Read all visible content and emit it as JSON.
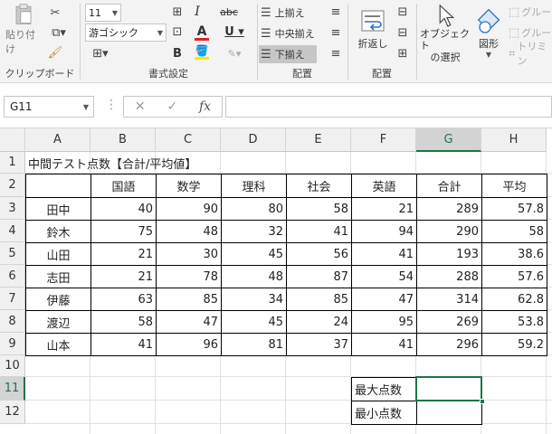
{
  "ribbon": {
    "clipboard": {
      "paste_label": "貼り付け",
      "group_label": "クリップボード"
    },
    "font": {
      "size_value": "11",
      "font_name": "游ゴシック",
      "group_label": "書式設定"
    },
    "alignment": {
      "top_label": "上揃え",
      "middle_label": "中央揃え",
      "bottom_label": "下揃え",
      "wrap_label": "折返し",
      "group_label": "配置"
    },
    "arrange": {
      "group_label": "配置",
      "select_objects_label": "オブジェクト\nの選択",
      "select_line1": "オブジェクト",
      "select_line2": "の選択",
      "shapes_label": "図形",
      "group_btn1": "グルー",
      "group_btn2": "グルー",
      "trim_label": "トリミン"
    }
  },
  "formula_bar": {
    "name_box": "G11",
    "formula": ""
  },
  "columns": [
    "A",
    "B",
    "C",
    "D",
    "E",
    "F",
    "G",
    "H"
  ],
  "selected_column": "G",
  "rows": [
    "1",
    "2",
    "3",
    "4",
    "5",
    "6",
    "7",
    "8",
    "9",
    "10",
    "11",
    "12"
  ],
  "selected_row": "11",
  "sheet": {
    "title": "中間テスト点数【合計/平均値】",
    "headers": [
      "国語",
      "数学",
      "理科",
      "社会",
      "英語",
      "合計",
      "平均"
    ],
    "records": [
      {
        "name": "田中",
        "values": [
          "40",
          "90",
          "80",
          "58",
          "21",
          "289",
          "57.8"
        ]
      },
      {
        "name": "鈴木",
        "values": [
          "75",
          "48",
          "32",
          "41",
          "94",
          "290",
          "58"
        ]
      },
      {
        "name": "山田",
        "values": [
          "21",
          "30",
          "45",
          "56",
          "41",
          "193",
          "38.6"
        ]
      },
      {
        "name": "志田",
        "values": [
          "21",
          "78",
          "48",
          "87",
          "54",
          "288",
          "57.6"
        ]
      },
      {
        "name": "伊藤",
        "values": [
          "63",
          "85",
          "34",
          "85",
          "47",
          "314",
          "62.8"
        ]
      },
      {
        "name": "渡辺",
        "values": [
          "58",
          "47",
          "45",
          "24",
          "95",
          "269",
          "53.8"
        ]
      },
      {
        "name": "山本",
        "values": [
          "41",
          "96",
          "81",
          "37",
          "41",
          "296",
          "59.2"
        ]
      }
    ],
    "max_label": "最大点数",
    "min_label": "最小点数"
  },
  "colors": {
    "accent": "#217346",
    "font_color_bar": "#e02020",
    "highlight_bar": "#ffe600"
  }
}
